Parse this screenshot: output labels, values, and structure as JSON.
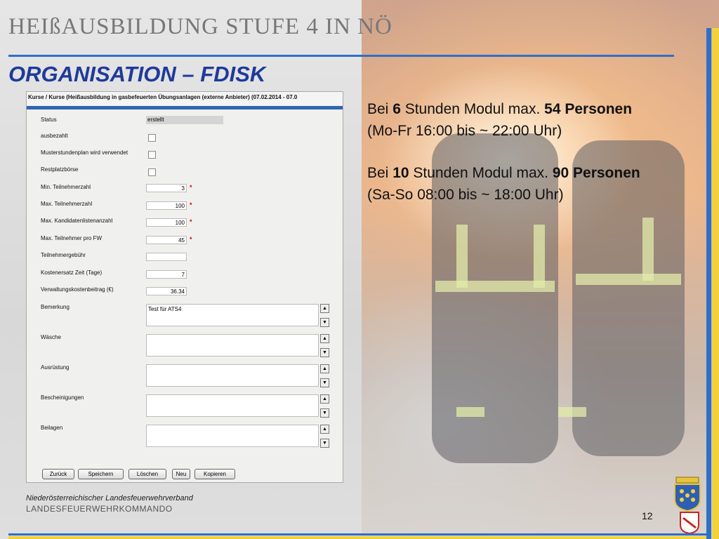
{
  "slide": {
    "title": "HEIßAUSBILDUNG STUFE 4 IN NÖ",
    "subtitle": "ORGANISATION – FDISK",
    "page_number": "12",
    "footer_org": "Niederösterreichischer Landesfeuerwehrverband",
    "footer_command": "LANDESFEUERWEHRKOMMANDO",
    "accent_blue": "#2f6fc9",
    "accent_yellow": "#f2d23c"
  },
  "form": {
    "header": "Kurse / Kurse (Heißausbildung in gasbefeuerten Übungsanlagen (externe Anbieter) (07.02.2014 - 07.0",
    "fields": [
      {
        "label": "Status",
        "value": "erstellt"
      },
      {
        "label": "ausbezahlt"
      },
      {
        "label": "Musterstundenplan wird verwendet"
      },
      {
        "label": "Restplatzbörse"
      },
      {
        "label": "Min. Teilnehmerzahl",
        "value": "3"
      },
      {
        "label": "Max. Teilnehmerzahl",
        "value": "100"
      },
      {
        "label": "Max. Kandidatenlistenanzahl",
        "value": "100"
      },
      {
        "label": "Max. Teilnehmer pro FW",
        "value": "45"
      },
      {
        "label": "Teilnehmergebühr",
        "value": ""
      },
      {
        "label": "Kostenersatz Zeit (Tage)",
        "value": "7"
      },
      {
        "label": "Verwaltungskostenbeitrag (€)",
        "value": "36.34"
      },
      {
        "label": "Bemerkung",
        "value": "Test für ATS4"
      },
      {
        "label": "Wäsche",
        "value": ""
      },
      {
        "label": "Ausrüstung",
        "value": ""
      },
      {
        "label": "Bescheinigungen",
        "value": ""
      },
      {
        "label": "Beilagen",
        "value": ""
      }
    ],
    "required_marker": "*",
    "buttons": {
      "back": "Zurück",
      "save": "Speichern",
      "delete": "Löschen",
      "new": "Neu",
      "copy": "Kopieren"
    }
  },
  "info": {
    "line1_a": "Bei ",
    "line1_b": "6",
    "line1_c": " Stunden Modul max. ",
    "line1_d": "54 Personen",
    "line2": "(Mo-Fr 16:00 bis ~ 22:00 Uhr)",
    "line3_a": "Bei ",
    "line3_b": "10",
    "line3_c": " Stunden Modul max. ",
    "line3_d": "90 Personen",
    "line4": "(Sa-So 08:00 bis ~ 18:00 Uhr)"
  }
}
